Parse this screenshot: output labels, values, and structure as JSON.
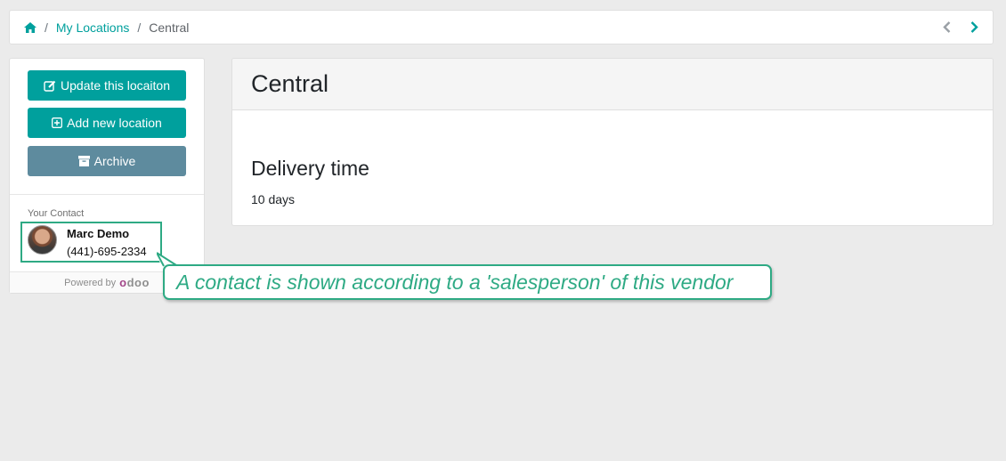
{
  "breadcrumb": {
    "home_icon": "home-icon",
    "items": [
      "My Locations",
      "Central"
    ],
    "separator": "/"
  },
  "pager": {
    "prev_icon": "chevron-left-icon",
    "next_icon": "chevron-right-icon"
  },
  "sidebar": {
    "buttons": {
      "update": {
        "label": "Update this locaiton",
        "icon": "edit-icon"
      },
      "add": {
        "label": "Add new location",
        "icon": "plus-square-icon"
      },
      "archive": {
        "label": "Archive",
        "icon": "archive-icon"
      }
    },
    "contact": {
      "label": "Your Contact",
      "name": "Marc Demo",
      "phone": "(441)-695-2334"
    },
    "powered_by": "Powered by",
    "brand": "odoo"
  },
  "main": {
    "title": "Central",
    "section_title": "Delivery time",
    "section_value": "10 days"
  },
  "callout": {
    "text": "A contact is shown according to a 'salesperson' of this vendor"
  },
  "colors": {
    "accent": "#00a09d",
    "secondary": "#5e8b9e",
    "callout": "#2eaa84"
  }
}
